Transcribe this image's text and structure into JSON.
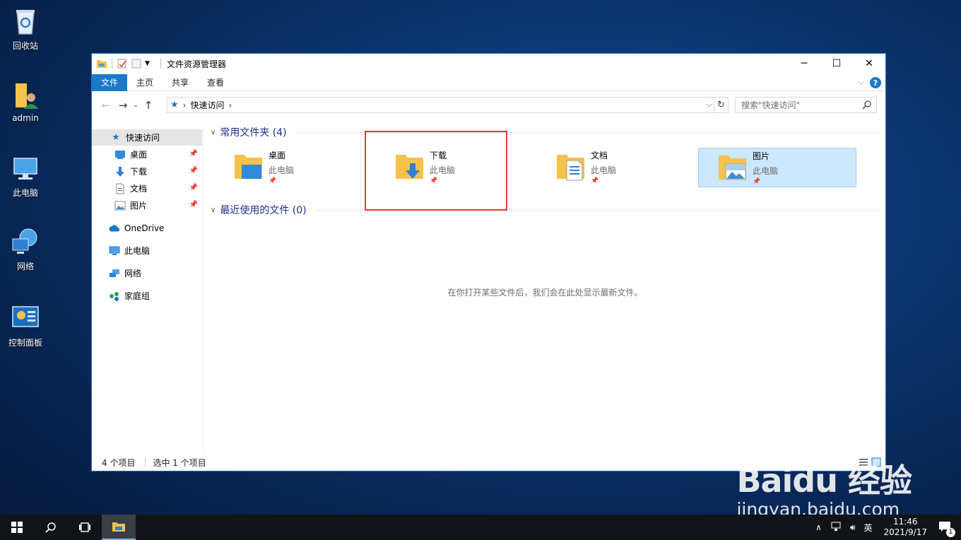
{
  "desktop": {
    "icons": [
      {
        "label": "回收站",
        "icon": "recycle-bin-icon"
      },
      {
        "label": "admin",
        "icon": "user-folder-icon"
      },
      {
        "label": "此电脑",
        "icon": "computer-icon"
      },
      {
        "label": "网络",
        "icon": "network-icon"
      },
      {
        "label": "控制面板",
        "icon": "control-panel-icon"
      }
    ]
  },
  "window": {
    "title": "文件资源管理器",
    "controls": {
      "minimize": "─",
      "maximize": "☐",
      "close": "✕"
    },
    "ribbon_tabs": [
      "文件",
      "主页",
      "共享",
      "查看"
    ],
    "address": {
      "location": "快速访问",
      "sep": "›"
    },
    "search": {
      "placeholder": "搜索\"快速访问\""
    },
    "nav": {
      "quick_access": "快速访问",
      "desktop": "桌面",
      "downloads": "下载",
      "documents": "文档",
      "pictures": "图片",
      "onedrive": "OneDrive",
      "this_pc": "此电脑",
      "network": "网络",
      "homegroup": "家庭组"
    },
    "groups": {
      "frequent": "常用文件夹 (4)",
      "recent": "最近使用的文件 (0)",
      "recent_empty": "在你打开某些文件后，我们会在此处显示最新文件。"
    },
    "folders": [
      {
        "name": "桌面",
        "location": "此电脑"
      },
      {
        "name": "下载",
        "location": "此电脑"
      },
      {
        "name": "文档",
        "location": "此电脑"
      },
      {
        "name": "图片",
        "location": "此电脑"
      }
    ],
    "status": {
      "count": "4 个项目",
      "selected": "选中 1 个项目"
    }
  },
  "taskbar": {
    "ime": "英",
    "time": "11:46",
    "date": "2021/9/17",
    "notifications": "1"
  },
  "watermark": {
    "big": "Baidu 经验",
    "small": "jingyan.baidu.com"
  },
  "colors": {
    "accent": "#1979ca",
    "selection": "#cce8ff",
    "highlight": "#e83b3b",
    "folder": "#f5c24c"
  }
}
